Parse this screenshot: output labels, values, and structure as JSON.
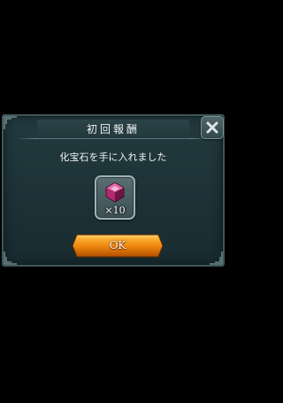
{
  "dialog": {
    "title": "初回報酬",
    "message": "化宝石を手に入れました",
    "close_icon": "close-x-icon"
  },
  "reward": {
    "icon": "pink-gem-icon",
    "quantity": "×10"
  },
  "actions": {
    "ok_label": "OK"
  },
  "colors": {
    "panel": "#1d3338",
    "border": "#3e585c",
    "ok_button": "#e8840c",
    "gem": "#c2327e"
  }
}
